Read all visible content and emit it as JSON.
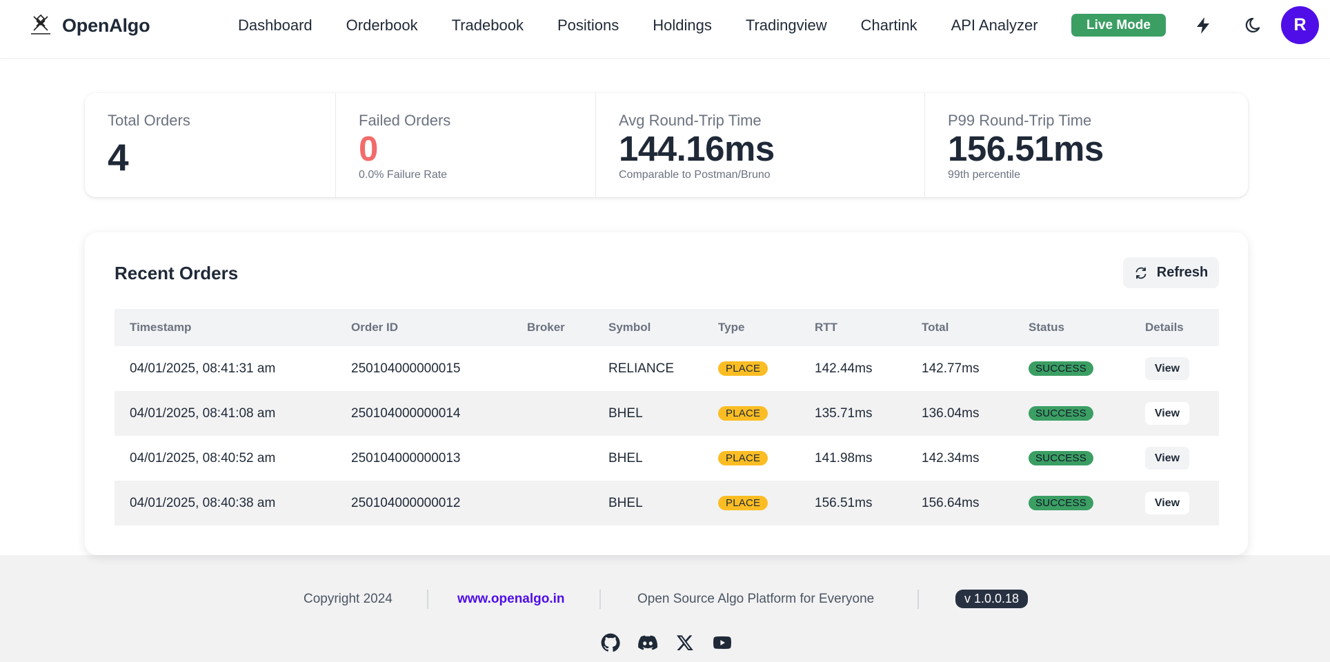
{
  "brand": {
    "name": "OpenAlgo"
  },
  "nav": {
    "links": [
      "Dashboard",
      "Orderbook",
      "Tradebook",
      "Positions",
      "Holdings",
      "Tradingview",
      "Chartink",
      "API Analyzer"
    ],
    "mode_badge": "Live Mode",
    "avatar_initial": "R",
    "icons": [
      "bolt-icon",
      "moon-icon"
    ]
  },
  "stats": {
    "total_orders": {
      "title": "Total Orders",
      "value": "4"
    },
    "failed_orders": {
      "title": "Failed Orders",
      "value": "0",
      "desc": "0.0% Failure Rate"
    },
    "avg_rtt": {
      "title": "Avg Round-Trip Time",
      "value": "144.16ms",
      "desc": "Comparable to Postman/Bruno"
    },
    "p99_rtt": {
      "title": "P99 Round-Trip Time",
      "value": "156.51ms",
      "desc": "99th percentile"
    }
  },
  "recent_orders": {
    "title": "Recent Orders",
    "refresh_label": "Refresh",
    "columns": [
      "Timestamp",
      "Order ID",
      "Broker",
      "Symbol",
      "Type",
      "RTT",
      "Total",
      "Status",
      "Details"
    ],
    "rows": [
      {
        "timestamp": "04/01/2025, 08:41:31 am",
        "order_id": "250104000000015",
        "broker": "",
        "symbol": "RELIANCE",
        "type": "PLACE",
        "rtt": "142.44ms",
        "total": "142.77ms",
        "status": "SUCCESS",
        "details": "View"
      },
      {
        "timestamp": "04/01/2025, 08:41:08 am",
        "order_id": "250104000000014",
        "broker": "",
        "symbol": "BHEL",
        "type": "PLACE",
        "rtt": "135.71ms",
        "total": "136.04ms",
        "status": "SUCCESS",
        "details": "View"
      },
      {
        "timestamp": "04/01/2025, 08:40:52 am",
        "order_id": "250104000000013",
        "broker": "",
        "symbol": "BHEL",
        "type": "PLACE",
        "rtt": "141.98ms",
        "total": "142.34ms",
        "status": "SUCCESS",
        "details": "View"
      },
      {
        "timestamp": "04/01/2025, 08:40:38 am",
        "order_id": "250104000000012",
        "broker": "",
        "symbol": "BHEL",
        "type": "PLACE",
        "rtt": "156.51ms",
        "total": "156.64ms",
        "status": "SUCCESS",
        "details": "View"
      }
    ]
  },
  "footer": {
    "copyright": "Copyright 2024",
    "link": "www.openalgo.in",
    "tagline": "Open Source Algo Platform for Everyone",
    "version": "v 1.0.0.18",
    "social_icons": [
      "github-icon",
      "discord-icon",
      "x-icon",
      "youtube-icon"
    ]
  },
  "colors": {
    "accent": "#4f0ee8",
    "live_green": "#3b9e63",
    "place_yellow": "#fbbd23",
    "failed_red": "#f26b6b"
  }
}
